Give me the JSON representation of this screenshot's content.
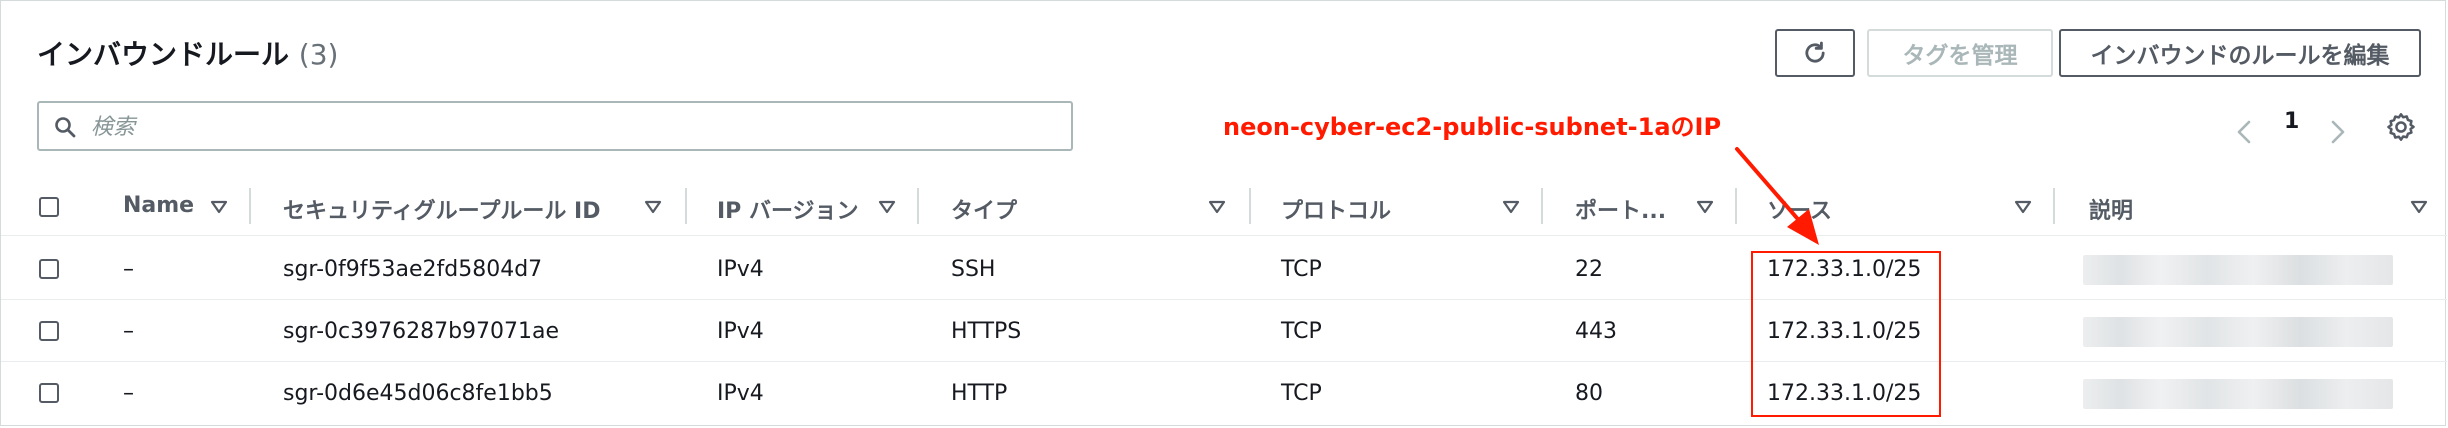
{
  "header": {
    "title": "インバウンドルール",
    "count": "(3)",
    "refresh_icon": "refresh-icon",
    "manage_tags_label": "タグを管理",
    "edit_rules_label": "インバウンドのルールを編集"
  },
  "search": {
    "placeholder": "検索",
    "value": ""
  },
  "pagination": {
    "current_page": "1"
  },
  "annotation": {
    "text": "neon-cyber-ec2-public-subnet-1aのIP",
    "color": "#ff1a00"
  },
  "table": {
    "columns": [
      "Name",
      "セキュリティグループルール ID",
      "IP バージョン",
      "タイプ",
      "プロトコル",
      "ポート...",
      "ソース",
      "説明"
    ],
    "rows": [
      {
        "name": "–",
        "rule_id": "sgr-0f9f53ae2fd5804d7",
        "ip_version": "IPv4",
        "type": "SSH",
        "protocol": "TCP",
        "port": "22",
        "source": "172.33.1.0/25"
      },
      {
        "name": "–",
        "rule_id": "sgr-0c3976287b97071ae",
        "ip_version": "IPv4",
        "type": "HTTPS",
        "protocol": "TCP",
        "port": "443",
        "source": "172.33.1.0/25"
      },
      {
        "name": "–",
        "rule_id": "sgr-0d6e45d06c8fe1bb5",
        "ip_version": "IPv4",
        "type": "HTTP",
        "protocol": "TCP",
        "port": "80",
        "source": "172.33.1.0/25"
      }
    ]
  },
  "colors": {
    "accent_red": "#ff1a00",
    "border": "#545b64",
    "muted": "#687078"
  }
}
